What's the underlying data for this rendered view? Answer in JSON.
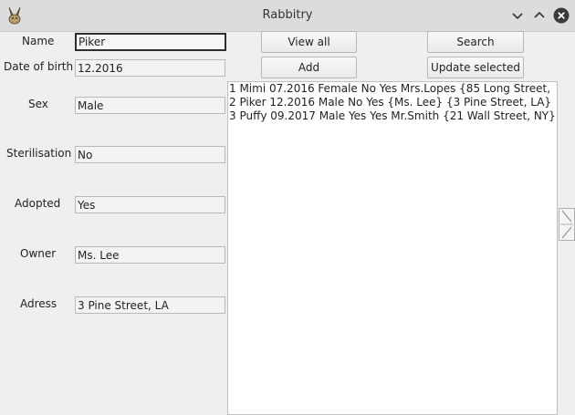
{
  "window": {
    "title": "Rabbitry"
  },
  "form": {
    "name": {
      "label": "Name",
      "value": "Piker"
    },
    "date_of_birth": {
      "label": "Date of birth",
      "value": "12.2016"
    },
    "sex": {
      "label": "Sex",
      "value": "Male"
    },
    "sterilisation": {
      "label": "Sterilisation",
      "value": "No"
    },
    "adopted": {
      "label": "Adopted",
      "value": "Yes"
    },
    "owner": {
      "label": "Owner",
      "value": "Ms. Lee"
    },
    "address": {
      "label": "Adress",
      "value": "3 Pine Street, LA"
    }
  },
  "buttons": {
    "view_all": "View all",
    "search": "Search",
    "add": "Add",
    "update_selected": "Update selected"
  },
  "list": {
    "rows": [
      "1 Mimi 07.2016 Female No Yes Mrs.Lopes {85 Long Street, ",
      "2 Piker 12.2016 Male No Yes {Ms. Lee} {3 Pine Street, LA}",
      "3 Puffy 09.2017 Male Yes Yes Mr.Smith {21 Wall Street, NY}"
    ]
  },
  "icons": {
    "app": "rabbit-icon",
    "minimize": "chevron-down-icon",
    "maximize": "chevron-up-icon",
    "close": "close-icon"
  },
  "colors": {
    "titlebar": "#dcdcdc",
    "window": "#efefef",
    "field": "#f3f3f3",
    "list": "#ffffff"
  }
}
